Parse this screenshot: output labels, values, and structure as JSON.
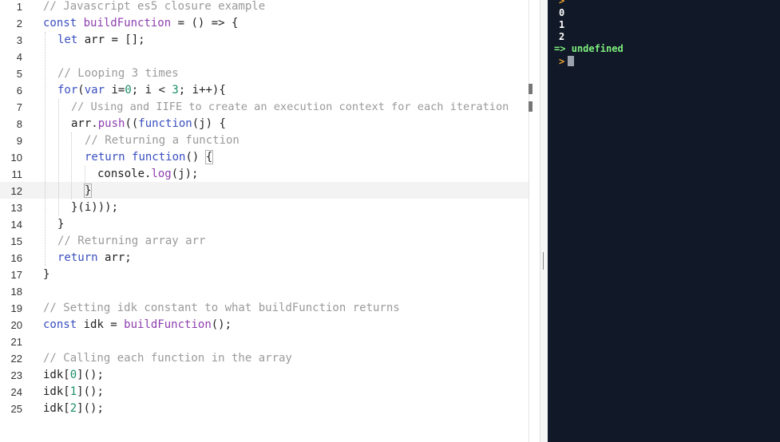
{
  "editor": {
    "highlighted_line": "12",
    "line_numbers": [
      "1",
      "2",
      "3",
      "4",
      "5",
      "6",
      "7",
      "8",
      "9",
      "10",
      "11",
      "12",
      "13",
      "14",
      "15",
      "16",
      "17",
      "18",
      "19",
      "20",
      "21",
      "22",
      "23",
      "24",
      "25"
    ],
    "lines": {
      "l1": {
        "comment": "// Javascript es5 closure example"
      },
      "l2": {
        "kw": "const",
        "name": "buildFunction",
        "rest": " = () => {"
      },
      "l3": {
        "kw": "let",
        "rest": " arr = [];"
      },
      "l5": {
        "comment": "// Looping 3 times"
      },
      "l6": {
        "kw1": "for",
        "p1": "(",
        "kw2": "var",
        "p2": " i=",
        "n1": "0",
        "p3": "; i < ",
        "n2": "3",
        "p4": "; i++){"
      },
      "l7": {
        "comment": "// Using and IIFE to create an execution context for each iteration"
      },
      "l8": {
        "obj": "arr.",
        "method": "push",
        "p1": "((",
        "kw": "function",
        "p2": "(j) {"
      },
      "l9": {
        "comment": "// Returning a function"
      },
      "l10": {
        "kw1": "return",
        "kw2": "function",
        "p1": "() ",
        "brace": "{"
      },
      "l11": {
        "obj": "console.",
        "method": "log",
        "p1": "(j);"
      },
      "l12": {
        "brace": "}"
      },
      "l13": {
        "text": "}(i)));"
      },
      "l14": {
        "text": "}"
      },
      "l15": {
        "comment": "// Returning array arr"
      },
      "l16": {
        "kw": "return",
        "rest": " arr;"
      },
      "l17": {
        "text": "}"
      },
      "l19": {
        "comment": "// Setting idk constant to what buildFunction returns"
      },
      "l20": {
        "kw": "const",
        "p1": " idk = ",
        "fn": "buildFunction",
        "p2": "();"
      },
      "l22": {
        "comment": "// Calling each function in the array"
      },
      "l23": {
        "p1": "idk[",
        "n": "0",
        "p2": "]();"
      },
      "l24": {
        "p1": "idk[",
        "n": "1",
        "p2": "]();"
      },
      "l25": {
        "p1": "idk[",
        "n": "2",
        "p2": "]();"
      }
    }
  },
  "console": {
    "prompt_symbol": ">",
    "outputs": [
      "0",
      "1",
      "2"
    ],
    "result_arrow": "=>",
    "result_value": "undefined",
    "colors": {
      "background": "#111827",
      "result": "#7ef07e",
      "prompt": "#f0a830",
      "output": "#ffffff"
    }
  }
}
